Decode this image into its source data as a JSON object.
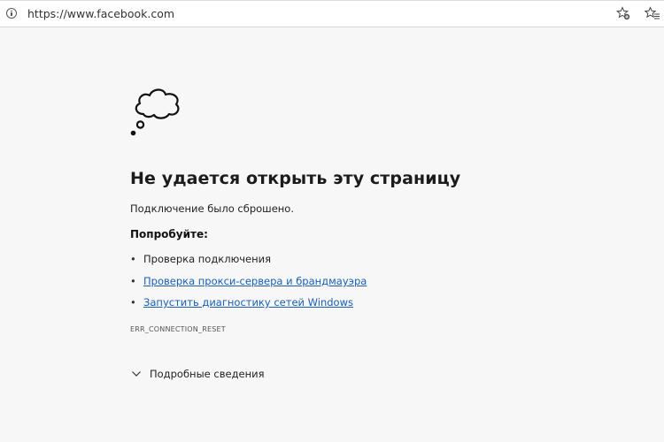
{
  "browser": {
    "url": "https://www.facebook.com",
    "icons": {
      "site_info": "info-icon",
      "add_favorite": "star-plus-icon",
      "favorites": "favorites-list-icon"
    }
  },
  "error_page": {
    "illustration": "thought-cloud-icon",
    "title": "Не удается открыть эту страницу",
    "message": "Подключение было сброшено.",
    "try_heading": "Попробуйте:",
    "suggestions": [
      {
        "bullet": "•",
        "label": "Проверка подключения",
        "is_link": false
      },
      {
        "bullet": "•",
        "label": "Проверка прокси-сервера и брандмауэра",
        "is_link": true
      },
      {
        "bullet": "•",
        "label": "Запустить диагностику сетей Windows",
        "is_link": true
      }
    ],
    "error_code": "ERR_CONNECTION_RESET",
    "details_label": "Подробные сведения",
    "details_icon": "chevron-down-icon"
  },
  "colors": {
    "background": "#f7f7f7",
    "link": "#1a5fb4",
    "text": "#1b1b1b"
  }
}
